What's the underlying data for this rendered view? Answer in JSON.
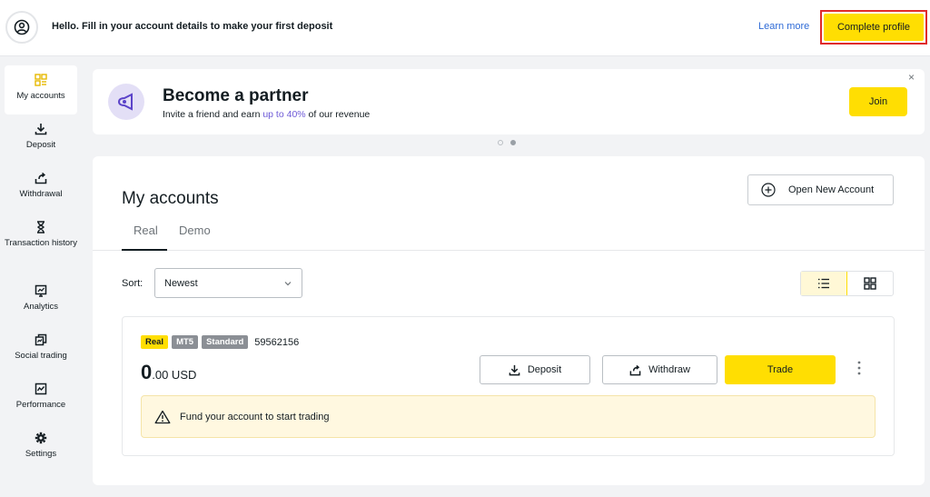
{
  "header": {
    "greeting": "Hello. Fill in your account details to make your first deposit",
    "learn_more": "Learn more",
    "complete_profile": "Complete profile"
  },
  "sidebar": {
    "items": [
      {
        "label": "My accounts",
        "icon": "grid-accounts-icon",
        "active": true
      },
      {
        "label": "Deposit",
        "icon": "download-icon"
      },
      {
        "label": "Withdrawal",
        "icon": "upload-arrow-icon"
      },
      {
        "label": "Transaction history",
        "icon": "hourglass-icon"
      },
      {
        "label": "Analytics",
        "icon": "analytics-icon"
      },
      {
        "label": "Social trading",
        "icon": "social-trading-icon"
      },
      {
        "label": "Performance",
        "icon": "performance-icon"
      },
      {
        "label": "Settings",
        "icon": "gear-icon"
      }
    ]
  },
  "banner": {
    "title": "Become a partner",
    "subtitle_prefix": "Invite a friend and earn ",
    "subtitle_highlight": "up to 40%",
    "subtitle_suffix": " of our revenue",
    "join": "Join",
    "close": "×"
  },
  "main": {
    "title": "My accounts",
    "tabs": [
      "Real",
      "Demo"
    ],
    "open_new_account": "Open New Account",
    "sort_label": "Sort:",
    "sort_value": "Newest"
  },
  "account": {
    "badges": [
      "Real",
      "MT5",
      "Standard"
    ],
    "number": "59562156",
    "balance_int": "0",
    "balance_rest": ".00 USD",
    "deposit": "Deposit",
    "withdraw": "Withdraw",
    "trade": "Trade",
    "notice": "Fund your account to start trading"
  },
  "colors": {
    "accent": "#ffde02",
    "highlight": "#6f5bd7",
    "link": "#2e6ad6",
    "outline": "#e02b2b"
  }
}
